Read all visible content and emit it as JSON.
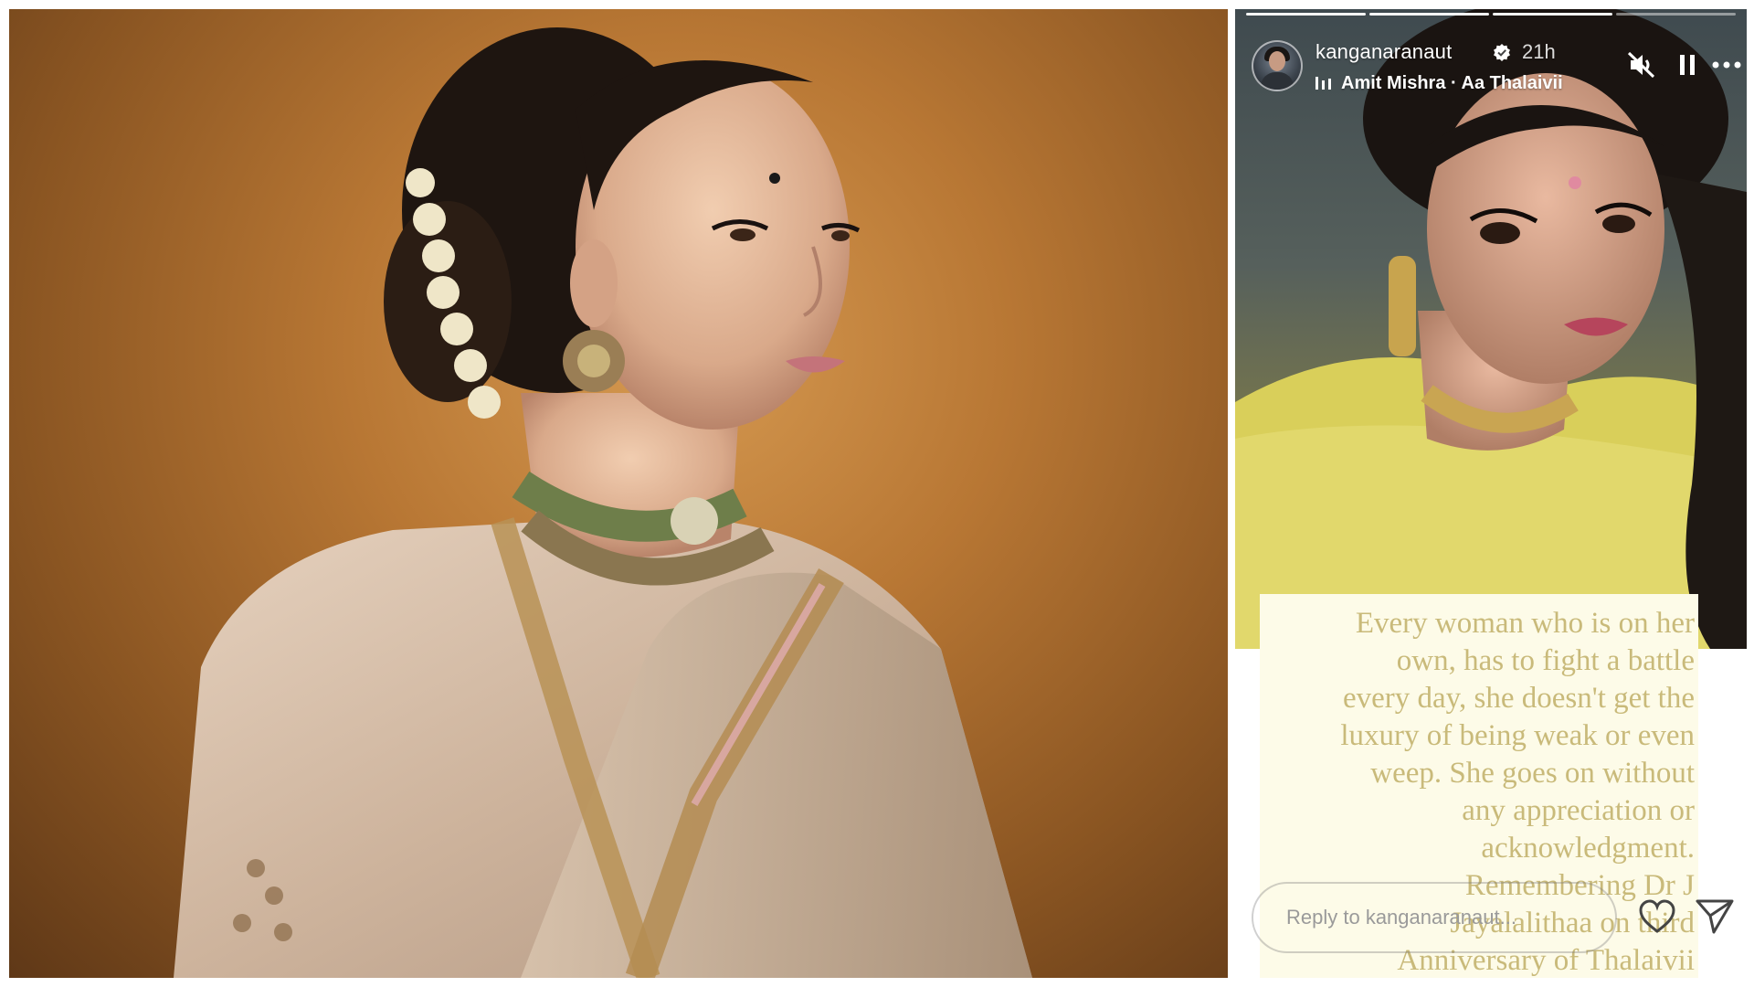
{
  "left_photo": {
    "subject": "portrait-photo"
  },
  "story": {
    "progress_segments": 4,
    "header": {
      "username": "kanganaranaut",
      "time_ago": "21h",
      "music": "Amit Mishra · Aa Thalaivii"
    },
    "caption": "Every woman who is on her\nown, has to fight a battle\nevery day, she doesn't get the\nluxury of being weak or even\nweep.  She goes on without\nany appreciation or\nacknowledgment.\nRemembering Dr J\nJayalalithaa on third\nAnniversary of Thalaivii",
    "reply": {
      "placeholder": "Reply to kanganaranaut..."
    },
    "icons": {
      "verified": "verified-badge-icon",
      "music": "music-bars-icon",
      "mute": "speaker-muted-icon",
      "pause": "pause-icon",
      "more": "more-dots-icon",
      "heart": "heart-icon",
      "send": "send-icon"
    },
    "colors": {
      "caption_text": "#c9ba7a",
      "caption_bg": "#fdfbe8",
      "verified_badge": "#ffffff"
    }
  }
}
